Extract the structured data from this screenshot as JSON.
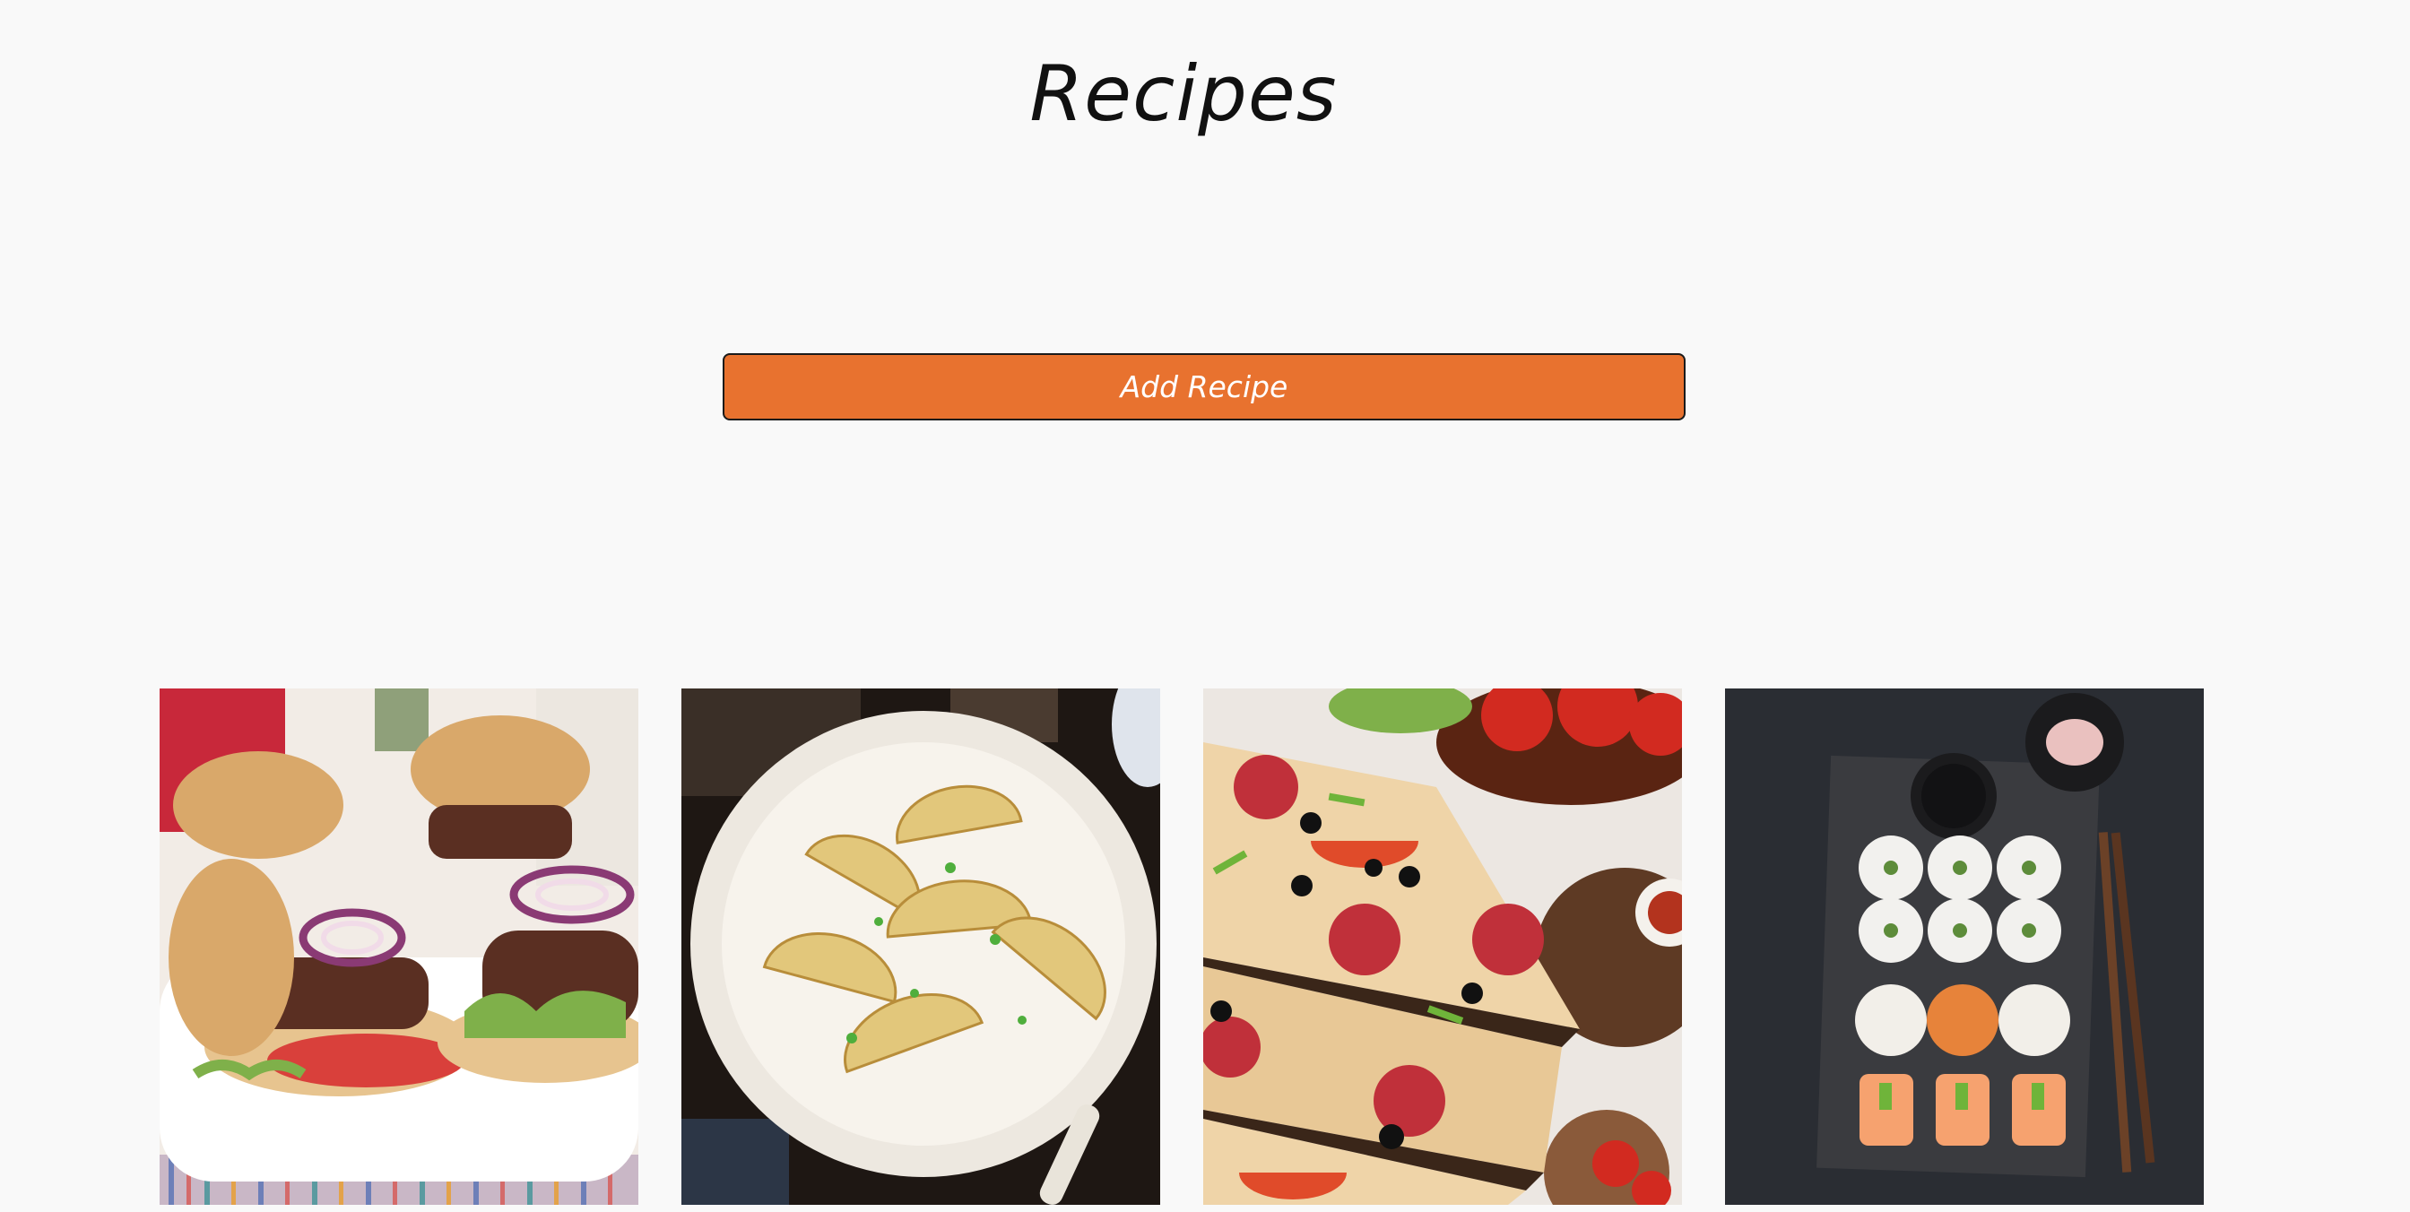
{
  "header": {
    "title": "Recipes"
  },
  "actions": {
    "add_label": "Add Recipe"
  },
  "colors": {
    "background": "#f9f9f9",
    "accent": "#e8722f",
    "button_border": "#1a1a1a"
  },
  "recipes": [
    {
      "name": "",
      "image_icon": "burger-image"
    },
    {
      "name": "",
      "image_icon": "dumplings-image"
    },
    {
      "name": "",
      "image_icon": "pizza-image"
    },
    {
      "name": "",
      "image_icon": "sushi-image"
    }
  ]
}
